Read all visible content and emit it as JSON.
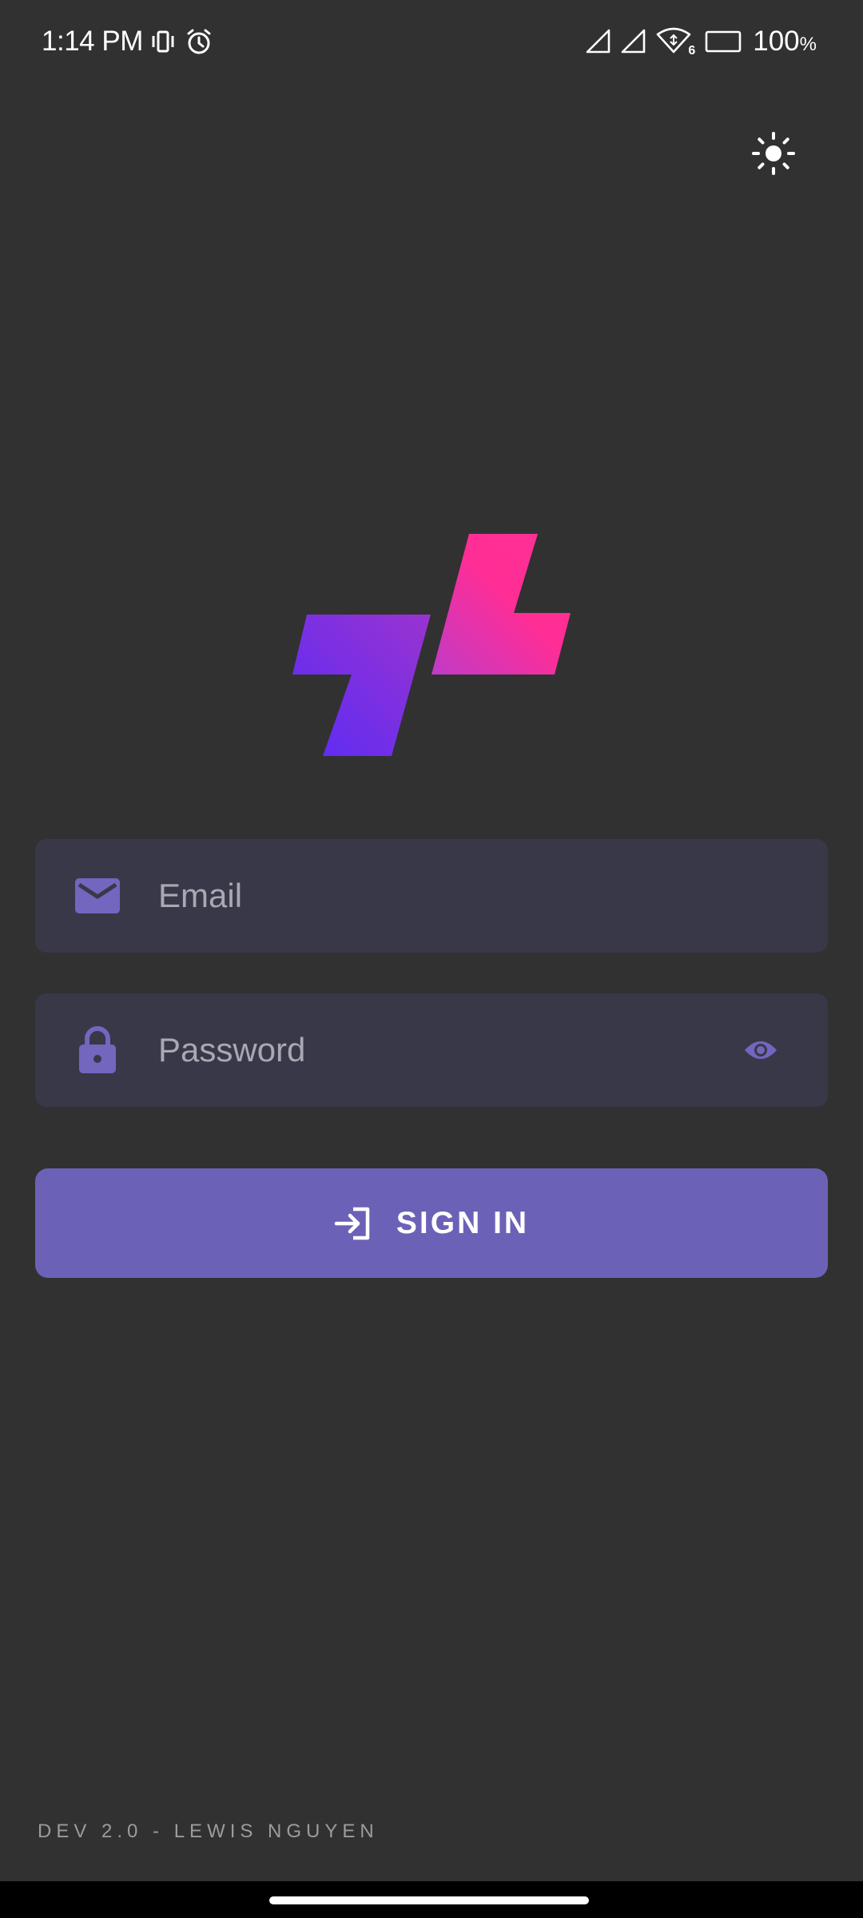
{
  "status_bar": {
    "time": "1:14 PM",
    "battery_level": "100",
    "battery_unit": "%",
    "wifi_badge": "6",
    "icons": [
      "vibrate-icon",
      "alarm-icon",
      "signal-icon",
      "signal-icon",
      "wifi-icon",
      "battery-icon"
    ]
  },
  "header": {
    "theme_toggle_icon": "sun-icon"
  },
  "logo": {
    "icon": "app-logo",
    "colors": {
      "left_gradient": [
        "#6a2bf0",
        "#8a34d8"
      ],
      "right_gradient": [
        "#d83bb8",
        "#ff2d95"
      ]
    }
  },
  "login_form": {
    "email": {
      "placeholder": "Email",
      "value": "",
      "icon": "email-icon"
    },
    "password": {
      "placeholder": "Password",
      "value": "",
      "icon": "lock-icon",
      "toggle_icon": "eye-icon"
    },
    "sign_in": {
      "label": "SIGN IN",
      "icon": "login-icon"
    }
  },
  "footer": {
    "text": "DEV 2.0 - LEWIS NGUYEN"
  },
  "colors": {
    "background": "#313131",
    "field_background": "#393848",
    "accent": "#6b62b7",
    "icon_accent": "#7266be",
    "placeholder": "#a9a8b3",
    "footer_text": "#9c9c9c"
  }
}
